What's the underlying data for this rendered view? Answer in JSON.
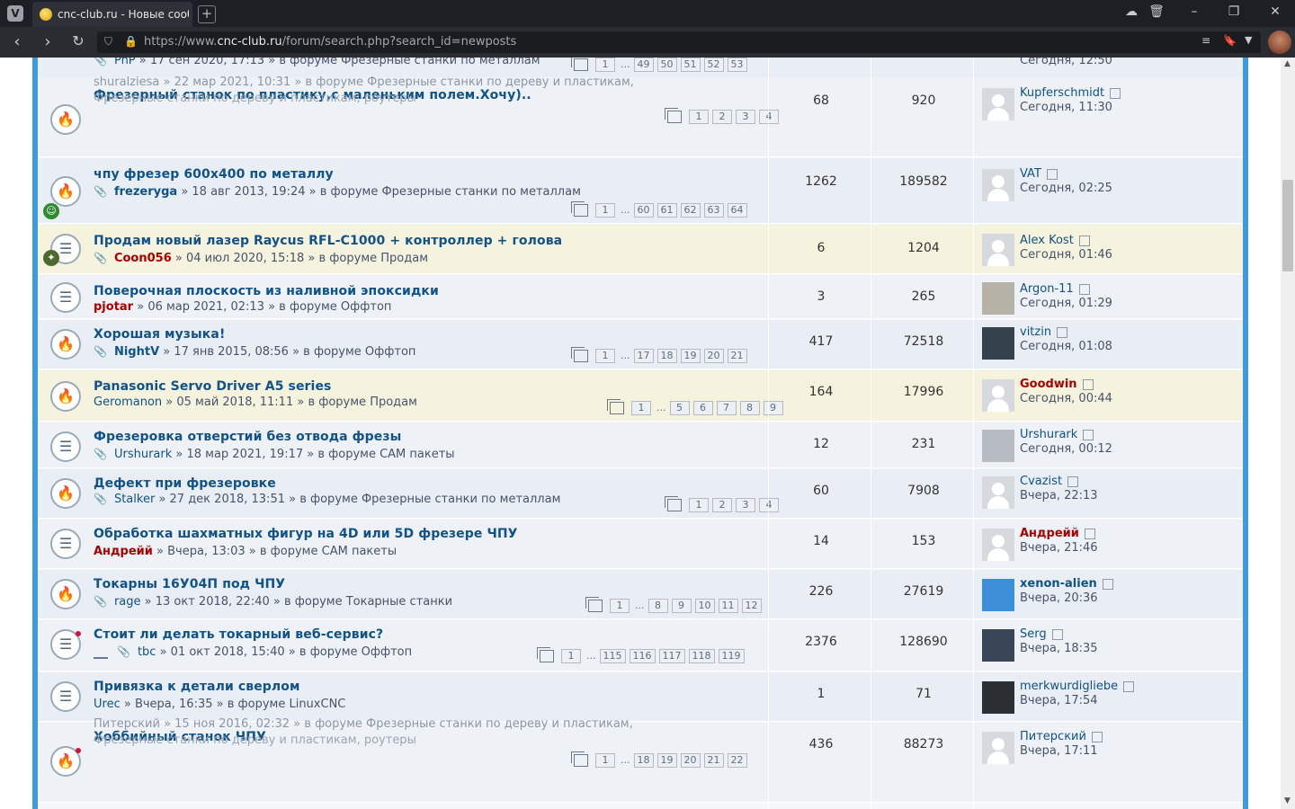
{
  "browser": {
    "tab_title": "cnc-club.ru - Новые сообщ",
    "url_prefix": "https://www.",
    "url_domain": "cnc-club.ru",
    "url_path": "/forum/search.php?search_id=newposts",
    "newtab": "+",
    "icons": [
      "cloud-icon",
      "trash-icon",
      "minimize-icon",
      "restore-icon",
      "close-icon",
      "back-icon",
      "forward-icon",
      "reload-icon",
      "shield-icon",
      "lock-icon",
      "reader-icon",
      "bookmark-icon",
      "menu-icon"
    ]
  },
  "partial_top": {
    "author": "PnP",
    "meta": "» 17 сен 2020, 17:13 » в форуме Фрезерные станки по металлам",
    "pages": [
      "1",
      "...",
      "49",
      "50",
      "51",
      "52",
      "53"
    ],
    "last_time": "Сегодня, 12:50"
  },
  "topics": [
    {
      "title": "Фрезерный станок по пластику,с маленьким полем.Хочу)..",
      "ghost_top": "shuralziesa » 22 мар 2021, 10:31 » в форуме Фрезерные станки по дереву и пластикам,",
      "ghost_bottom": "Фрезерные станки по дереву и пластикам, роутеры",
      "pages": [
        "1",
        "2",
        "3",
        "4"
      ],
      "replies": "68",
      "views": "920",
      "last_author": "Kupferschmidt",
      "last_time": "Сегодня, 11:30"
    },
    {
      "title": "чпу фрезер 600x400 по металлу",
      "author": "frezeryga",
      "meta": "» 18 авг 2013, 19:24 » в форуме Фрезерные станки по металлам",
      "pages": [
        "1",
        "...",
        "60",
        "61",
        "62",
        "63",
        "64"
      ],
      "replies": "1262",
      "views": "189582",
      "last_author": "VAT",
      "last_time": "Сегодня, 02:25"
    },
    {
      "title": "Продам новый лазер Raycus RFL-C1000 + контроллер + голова",
      "author": "Coon056",
      "meta": "» 04 июл 2020, 15:18 » в форуме Продам",
      "replies": "6",
      "views": "1204",
      "last_author": "Alex Kost",
      "last_time": "Сегодня, 01:46"
    },
    {
      "title": "Поверочная плоскость из наливной эпоксидки",
      "author": "pjotar",
      "meta": "» 06 мар 2021, 02:13 » в форуме Оффтоп",
      "replies": "3",
      "views": "265",
      "last_author": "Argon-11",
      "last_time": "Сегодня, 01:29"
    },
    {
      "title": "Хорошая музыка!",
      "author": "NightV",
      "meta": "» 17 янв 2015, 08:56 » в форуме Оффтоп",
      "pages": [
        "1",
        "...",
        "17",
        "18",
        "19",
        "20",
        "21"
      ],
      "replies": "417",
      "views": "72518",
      "last_author": "vitzin",
      "last_time": "Сегодня, 01:08"
    },
    {
      "title": "Panasonic Servo Driver A5 series",
      "author": "Geromanon",
      "meta": "» 05 май 2018, 11:11 » в форуме Продам",
      "pages": [
        "1",
        "...",
        "5",
        "6",
        "7",
        "8",
        "9"
      ],
      "replies": "164",
      "views": "17996",
      "last_author": "Goodwin",
      "last_time": "Сегодня, 00:44"
    },
    {
      "title": "Фрезеровка отверстий без отвода фрезы",
      "author": "Urshurark",
      "meta": "» 18 мар 2021, 19:17 » в форуме CAM пакеты",
      "replies": "12",
      "views": "231",
      "last_author": "Urshurark",
      "last_time": "Сегодня, 00:12"
    },
    {
      "title": "Дефект при фрезеровке",
      "author": "Stalker",
      "meta": "» 27 дек 2018, 13:51 » в форуме Фрезерные станки по металлам",
      "pages": [
        "1",
        "2",
        "3",
        "4"
      ],
      "replies": "60",
      "views": "7908",
      "last_author": "Cvazist",
      "last_time": "Вчера, 22:13"
    },
    {
      "title": "Обработка шахматных фигур на 4D или 5D фрезере ЧПУ",
      "author": "Андрейй",
      "meta": "» Вчера, 13:03 » в форуме CAM пакеты",
      "replies": "14",
      "views": "153",
      "last_author": "Андрейй",
      "last_time": "Вчера, 21:46"
    },
    {
      "title": "Токарны 16У04П под ЧПУ",
      "author": "rage",
      "meta": "» 13 окт 2018, 22:40 » в форуме Токарные станки",
      "pages": [
        "1",
        "...",
        "8",
        "9",
        "10",
        "11",
        "12"
      ],
      "replies": "226",
      "views": "27619",
      "last_author": "xenon-alien",
      "last_time": "Вчера, 20:36"
    },
    {
      "title": "Стоит ли делать токарный веб-сервис?",
      "author": "tbc",
      "meta": "» 01 окт 2018, 15:40 » в форуме Оффтоп",
      "pages": [
        "1",
        "...",
        "115",
        "116",
        "117",
        "118",
        "119"
      ],
      "replies": "2376",
      "views": "128690",
      "last_author": "Serg",
      "last_time": "Вчера, 18:35"
    },
    {
      "title": "Привязка к детали сверлом",
      "author": "Urec",
      "meta": "» Вчера, 16:35 » в форуме LinuxCNC",
      "replies": "1",
      "views": "71",
      "last_author": "merkwurdigliebe",
      "last_time": "Вчера, 17:54"
    },
    {
      "title": "Хоббийный станок ЧПУ",
      "ghost_top": "Питерский » 15 ноя 2016, 02:32 » в форуме Фрезерные станки по дереву и пластикам,",
      "ghost_bottom": "Фрезерные станки по дереву и пластикам, роутеры",
      "pages": [
        "1",
        "...",
        "18",
        "19",
        "20",
        "21",
        "22"
      ],
      "replies": "436",
      "views": "88273",
      "last_author": "Питерский",
      "last_time": "Вчера, 17:11"
    }
  ]
}
